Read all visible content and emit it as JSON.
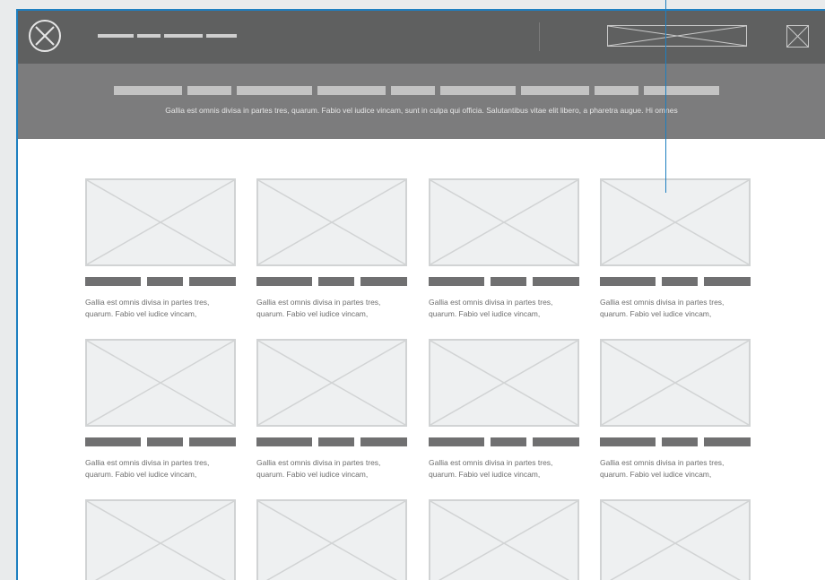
{
  "header": {
    "logo_icon": "placeholder-circle-x-icon",
    "nav_placeholder_count": 4,
    "search_icon": "placeholder-rect-x-icon",
    "close_icon": "close-square-icon"
  },
  "subheader": {
    "heading_placeholder_count": 9,
    "tagline": "Gallia est omnis divisa in partes tres, quarum. Fabio vel iudice vincam, sunt in culpa qui officia. Salutantibus vitae elit libero, a pharetra augue. Hi omnes"
  },
  "cards": [
    {
      "line1": "Gallia est omnis divisa in partes tres,",
      "line2": "quarum. Fabio vel iudice vincam,"
    },
    {
      "line1": "Gallia est omnis divisa in partes tres,",
      "line2": "quarum. Fabio vel iudice vincam,"
    },
    {
      "line1": "Gallia est omnis divisa in partes tres,",
      "line2": "quarum. Fabio vel iudice vincam,"
    },
    {
      "line1": "Gallia est omnis divisa in partes tres,",
      "line2": "quarum. Fabio vel iudice vincam,"
    },
    {
      "line1": "Gallia est omnis divisa in partes tres,",
      "line2": "quarum. Fabio vel iudice vincam,"
    },
    {
      "line1": "Gallia est omnis divisa in partes tres,",
      "line2": "quarum. Fabio vel iudice vincam,"
    },
    {
      "line1": "Gallia est omnis divisa in partes tres,",
      "line2": "quarum. Fabio vel iudice vincam,"
    },
    {
      "line1": "Gallia est omnis divisa in partes tres,",
      "line2": "quarum. Fabio vel iudice vincam,"
    },
    {
      "line1": "",
      "line2": ""
    },
    {
      "line1": "",
      "line2": ""
    },
    {
      "line1": "",
      "line2": ""
    },
    {
      "line1": "",
      "line2": ""
    }
  ],
  "colors": {
    "accent": "#1e7fc0",
    "header_bg": "#5f6060",
    "subheader_bg": "#7c7c7d",
    "placeholder_fill": "#eef0f1",
    "placeholder_stroke": "#d1d3d4"
  }
}
